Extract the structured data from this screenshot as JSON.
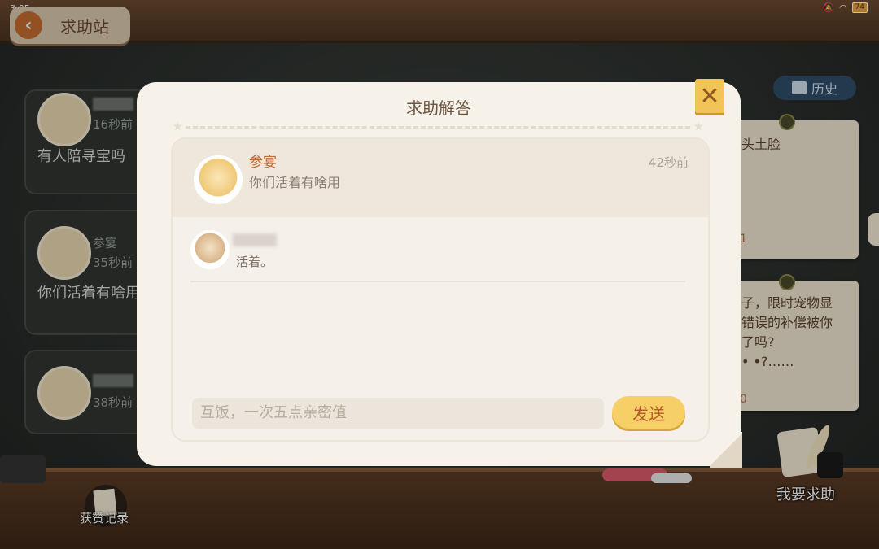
{
  "status_bar": {
    "time": "3:05",
    "battery": "74"
  },
  "header": {
    "title": "求助站"
  },
  "history_button": {
    "label": "历史"
  },
  "left_cards": [
    {
      "time": "16秒前",
      "text": "有人陪寻宝吗"
    },
    {
      "name": "参宴",
      "time": "35秒前",
      "text": "你们活着有啥用"
    },
    {
      "time": "38秒前",
      "text": ""
    }
  ],
  "right_cards": [
    {
      "text": "头土脸",
      "count": "1"
    },
    {
      "text": "子，限时宠物显\n错误的补偿被你\n了吗?\n• •?……",
      "count": "0"
    }
  ],
  "help_button": {
    "label": "我要求助"
  },
  "likes_button": {
    "label": "获赞记录"
  },
  "dialog": {
    "title": "求助解答",
    "question": {
      "name": "参宴",
      "time": "42秒前",
      "text": "你们活着有啥用"
    },
    "answers": [
      {
        "text": "活着。"
      }
    ],
    "input": {
      "placeholder": "互饭，一次五点亲密值"
    },
    "send_label": "发送"
  },
  "colors": {
    "accent": "#f0c456",
    "name": "#c06a36"
  }
}
